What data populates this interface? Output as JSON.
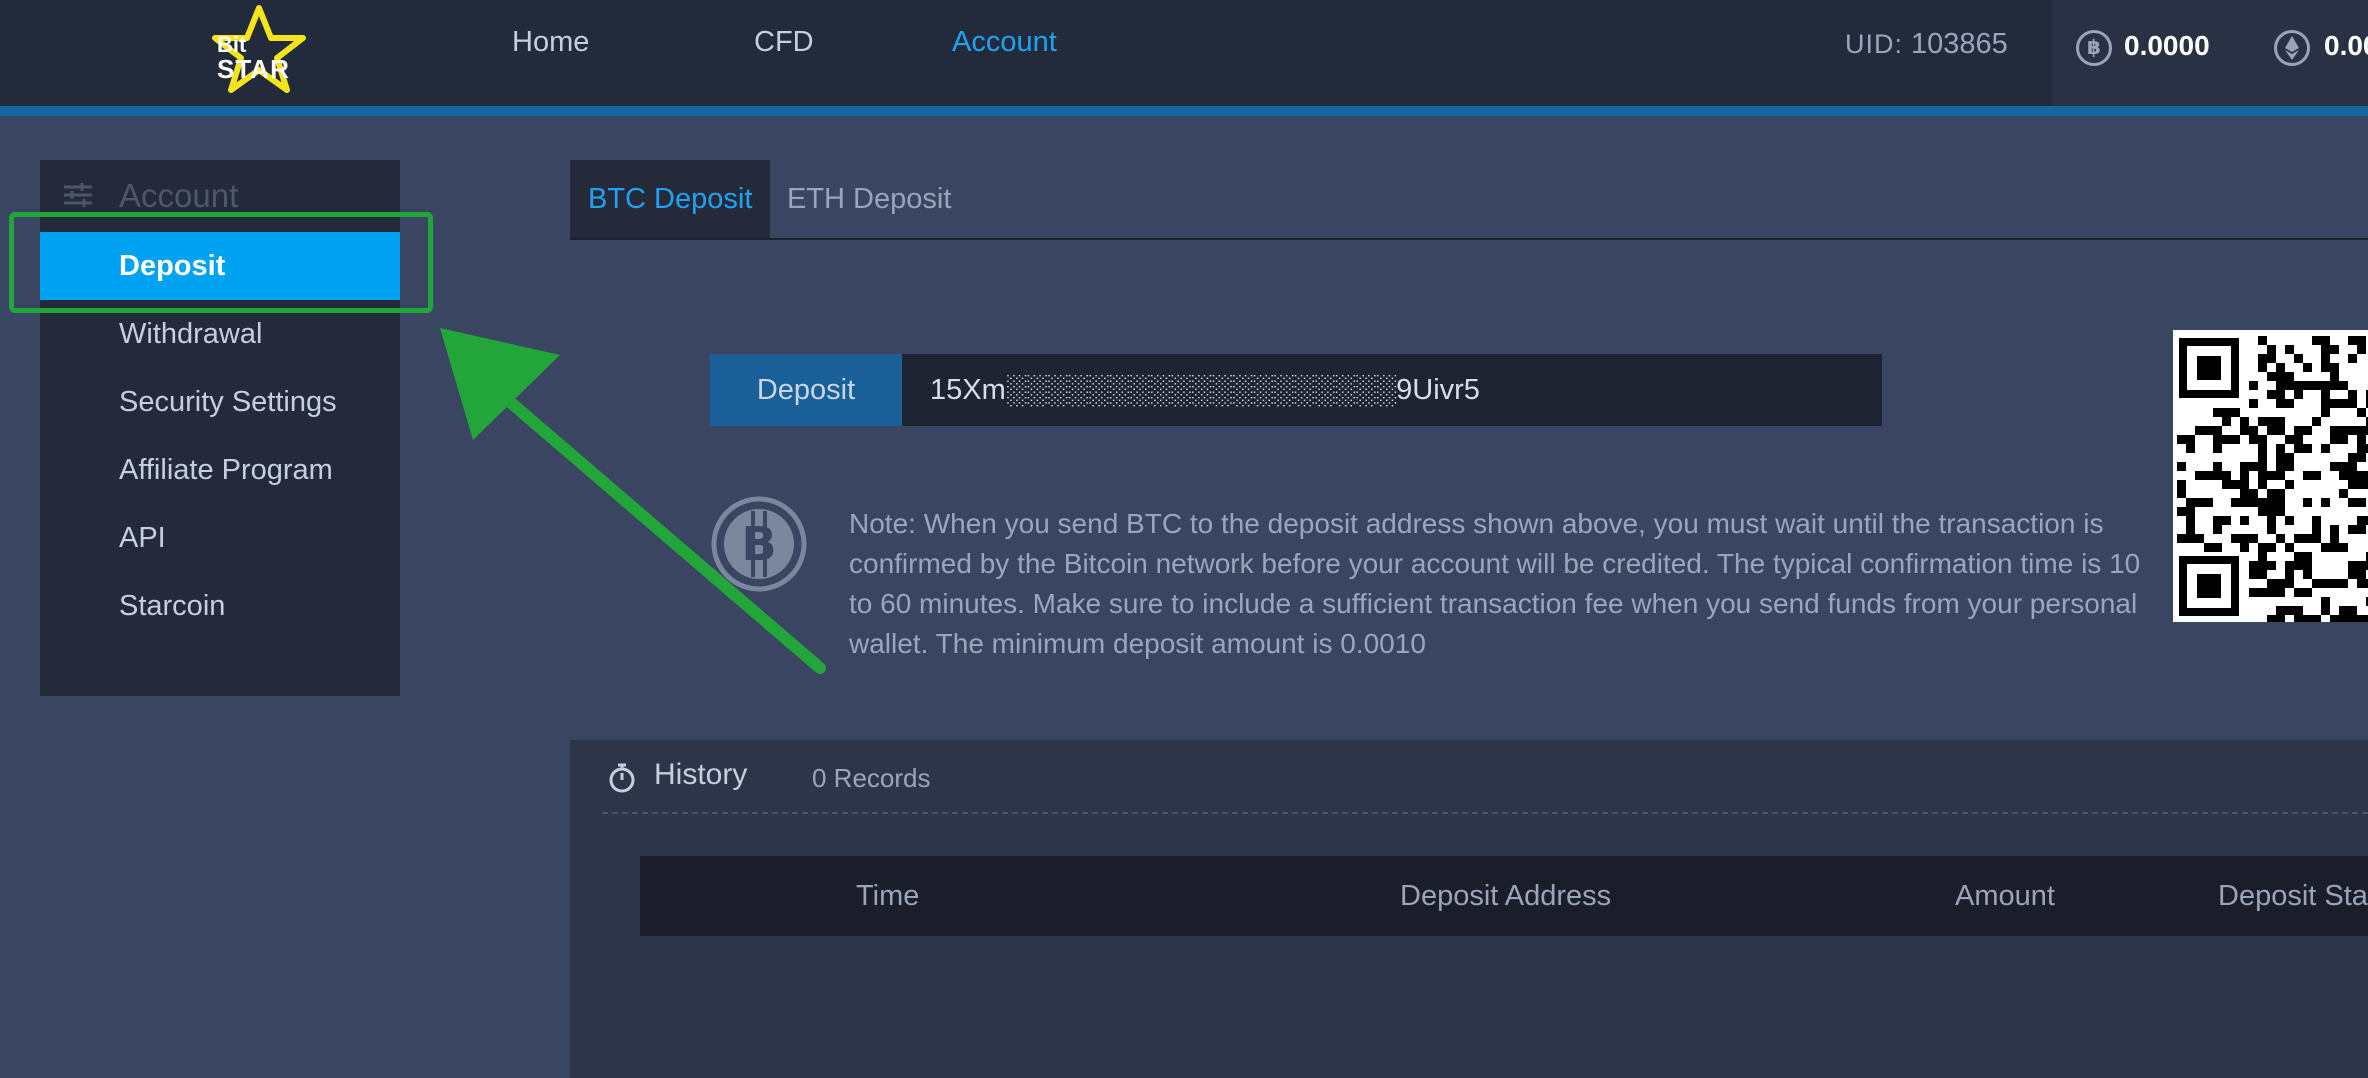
{
  "logo": {
    "line1": "Bit",
    "line2": "STAR"
  },
  "nav": {
    "home": "Home",
    "cfd": "CFD",
    "account": "Account"
  },
  "uid": {
    "label": "UID:",
    "value": "103865"
  },
  "balances": [
    {
      "coin": "BTC",
      "value": "0.0000"
    },
    {
      "coin": "ETH",
      "value": "0.00"
    }
  ],
  "sidebar": {
    "title": "Account",
    "items": [
      {
        "label": "Deposit"
      },
      {
        "label": "Withdrawal"
      },
      {
        "label": "Security Settings"
      },
      {
        "label": "Affiliate Program"
      },
      {
        "label": "API"
      },
      {
        "label": "Starcoin"
      }
    ]
  },
  "tabs": [
    {
      "label": "BTC Deposit"
    },
    {
      "label": "ETH Deposit"
    }
  ],
  "deposit": {
    "label": "Deposit",
    "address": "15Xm░░░░░░░░░░░░░░░░░░░9Uivr5"
  },
  "note": "Note: When you send BTC to the deposit address shown above, you must wait until the transaction is confirmed by the Bitcoin network before your account will be credited. The typical confirmation time is 10 to 60 minutes. Make sure to include a sufficient transaction fee when you send funds from your personal wallet. The minimum deposit amount is 0.0010",
  "history": {
    "title": "History",
    "count": "0 Records",
    "columns": [
      "Time",
      "Deposit Address",
      "Amount",
      "Deposit Sta"
    ]
  },
  "colors": {
    "accent": "#00a2f2",
    "annotation": "#22a63a",
    "nav_active": "#1fa3f0"
  }
}
